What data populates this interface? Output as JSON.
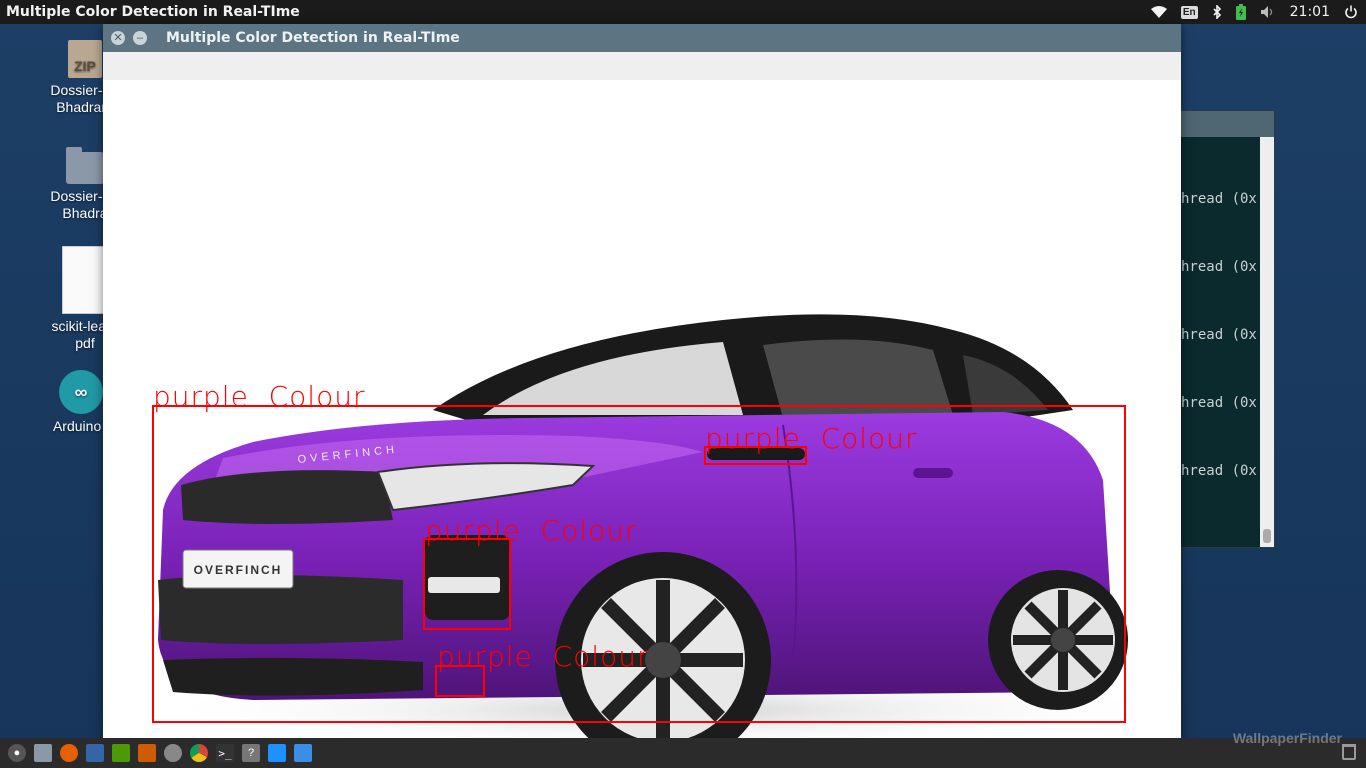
{
  "panel": {
    "active_title": "Multiple Color Detection in Real-TIme",
    "keyboard_layout": "En",
    "clock": "21:01"
  },
  "desktop_icons": [
    {
      "label": "Dossier-Sh\nBhadrara",
      "icon": "zip-archive-icon"
    },
    {
      "label": "Dossier-Sh\nBhadra",
      "icon": "folder-icon"
    },
    {
      "label": "scikit-learn\npdf",
      "icon": "pdf-document-icon"
    },
    {
      "label": "Arduino I",
      "icon": "arduino-icon"
    }
  ],
  "terminal": {
    "lines": [
      "hread (0x",
      "hread (0x",
      "hread (0x",
      "hread (0x",
      "hread (0x"
    ]
  },
  "window": {
    "title": "Multiple Color Detection in Real-TIme",
    "detections": [
      {
        "label": "purple  Colour"
      },
      {
        "label": "purple  Colour"
      },
      {
        "label": "purple  Colour"
      },
      {
        "label": "purple  Colour"
      }
    ],
    "car_badge": "OVERFINCH",
    "car_bonnet_text": "OVERFINCH"
  },
  "taskbar": {
    "icons": [
      "show-desktop-icon",
      "files-icon",
      "firefox-icon",
      "writer-icon",
      "calc-icon",
      "impress-icon",
      "settings-icon",
      "chrome-icon",
      "terminal-icon",
      "help-icon",
      "folder-blue-icon",
      "window-switcher-icon"
    ]
  },
  "watermark": "WallpaperFinder",
  "colors": {
    "panel": "#1b1b1b",
    "titlebar": "#5d7482",
    "detection_box": "#ff0000",
    "car_purple": "#7a22b8",
    "desktop": "#1b3c63"
  }
}
